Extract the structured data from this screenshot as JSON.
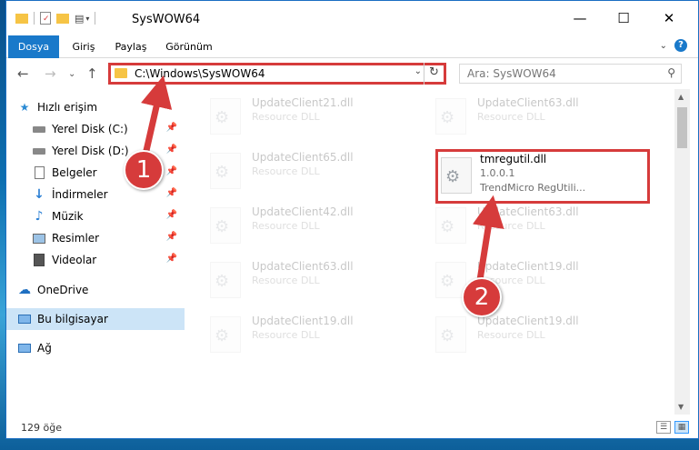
{
  "window": {
    "title": "SysWOW64"
  },
  "ribbon": {
    "tabs": [
      "Dosya",
      "Giriş",
      "Paylaş",
      "Görünüm"
    ],
    "active_tab": "Dosya"
  },
  "navbar": {
    "address_path": "C:\\Windows\\SysWOW64",
    "search_placeholder": "Ara: SysWOW64"
  },
  "sidebar": {
    "quick_access_label": "Hızlı erişim",
    "items": [
      {
        "label": "Yerel Disk (C:)",
        "icon": "drive-icon",
        "pinned": true
      },
      {
        "label": "Yerel Disk (D:)",
        "icon": "drive-icon",
        "pinned": true
      },
      {
        "label": "Belgeler",
        "icon": "documents-icon",
        "pinned": true
      },
      {
        "label": "İndirmeler",
        "icon": "download-icon",
        "pinned": true
      },
      {
        "label": "Müzik",
        "icon": "music-icon",
        "pinned": true
      },
      {
        "label": "Resimler",
        "icon": "pictures-icon",
        "pinned": true
      },
      {
        "label": "Videolar",
        "icon": "videos-icon",
        "pinned": true
      }
    ],
    "onedrive_label": "OneDrive",
    "this_pc_label": "Bu bilgisayar",
    "network_label": "Ağ"
  },
  "files": [
    {
      "name": "UpdateClient21.dll",
      "type": "Resource DLL",
      "faded": true
    },
    {
      "name": "UpdateClient63.dll",
      "type": "Resource DLL",
      "faded": true
    },
    {
      "name": "UpdateClient65.dll",
      "type": "Resource DLL",
      "faded": true
    },
    {
      "name": "tmregutil.dll",
      "version": "1.0.0.1",
      "description": "TrendMicro RegUtili...",
      "faded": false
    },
    {
      "name": "UpdateClient42.dll",
      "type": "Resource DLL",
      "faded": true
    },
    {
      "name": "UpdateClient63.dll",
      "type": "Resource DLL",
      "faded": true
    },
    {
      "name": "UpdateClient63.dll",
      "type": "Resource DLL",
      "faded": true
    },
    {
      "name": "UpdateClient19.dll",
      "type": "Resource DLL",
      "faded": true
    },
    {
      "name": "UpdateClient19.dll",
      "type": "Resource DLL",
      "faded": true
    },
    {
      "name": "UpdateClient19.dll",
      "type": "Resource DLL",
      "faded": true
    }
  ],
  "status": {
    "item_count": "129 öğe"
  },
  "annotations": {
    "step1": "1",
    "step2": "2",
    "color": "#d63b3b"
  }
}
